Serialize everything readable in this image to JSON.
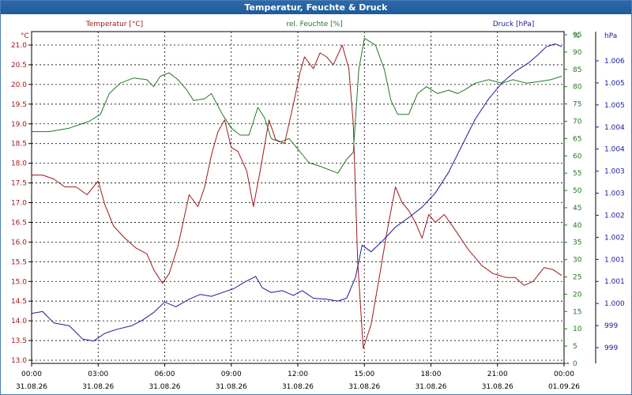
{
  "window": {
    "title": "Temperatur, Feuchte & Druck"
  },
  "chart_data": {
    "type": "line",
    "title": "Temperatur, Feuchte & Druck",
    "x": [
      "00:00 31.08.26",
      "03:00 31.08.26",
      "06:00 31.08.26",
      "09:00 31.08.26",
      "12:00 31.08.26",
      "15:00 31.08.26",
      "18:00 31.08.26",
      "21:00 31.08.26",
      "00:00 01.09.26"
    ],
    "x_hours_range": [
      0,
      24
    ],
    "grid": true,
    "axes": {
      "temperature": {
        "label": "Temperatur [°C]",
        "unit": "°C",
        "side": "left",
        "range": [
          13.0,
          21.0
        ],
        "ticks": [
          "13.0",
          "13.5",
          "14.0",
          "14.5",
          "15.0",
          "15.5",
          "16.0",
          "16.5",
          "17.0",
          "17.5",
          "18.0",
          "18.5",
          "19.0",
          "19.5",
          "20.0",
          "20.5",
          "21.0"
        ]
      },
      "humidity": {
        "label": "rel. Feuchte [%]",
        "unit": "%",
        "side": "right-inner",
        "range": [
          0,
          95
        ],
        "ticks": [
          "0",
          "5",
          "10",
          "15",
          "20",
          "25",
          "30",
          "35",
          "40",
          "45",
          "50",
          "55",
          "60",
          "65",
          "70",
          "75",
          "80",
          "85",
          "90",
          "95"
        ]
      },
      "pressure": {
        "label": "Druck [hPa]",
        "unit": "hPa",
        "side": "right-outer",
        "ticks": [
          "999",
          "999",
          "1.000",
          "1.001",
          "1.001",
          "1.002",
          "1.002",
          "1.003",
          "1.003",
          "1.004",
          "1.004",
          "1.005",
          "1.005",
          "1.006"
        ]
      }
    },
    "x_tick_times": [
      "00:00",
      "03:00",
      "06:00",
      "09:00",
      "12:00",
      "15:00",
      "18:00",
      "21:00",
      "00:00"
    ],
    "x_tick_dates": [
      "31.08.26",
      "31.08.26",
      "31.08.26",
      "31.08.26",
      "31.08.26",
      "31.08.26",
      "31.08.26",
      "31.08.26",
      "01.09.26"
    ],
    "series": [
      {
        "name": "Temperatur [°C]",
        "axis": "temperature",
        "color": "#a01818",
        "points": [
          [
            0,
            17.7
          ],
          [
            0.5,
            17.7
          ],
          [
            1,
            17.6
          ],
          [
            1.5,
            17.4
          ],
          [
            2,
            17.4
          ],
          [
            2.5,
            17.2
          ],
          [
            3,
            17.55
          ],
          [
            3.3,
            16.95
          ],
          [
            3.7,
            16.4
          ],
          [
            4.2,
            16.1
          ],
          [
            4.7,
            15.85
          ],
          [
            5.2,
            15.7
          ],
          [
            5.5,
            15.3
          ],
          [
            5.9,
            14.95
          ],
          [
            6.2,
            15.2
          ],
          [
            6.6,
            15.9
          ],
          [
            7.1,
            17.2
          ],
          [
            7.5,
            16.9
          ],
          [
            7.8,
            17.4
          ],
          [
            8.1,
            18.2
          ],
          [
            8.4,
            18.8
          ],
          [
            8.7,
            19.1
          ],
          [
            9.0,
            18.4
          ],
          [
            9.3,
            18.3
          ],
          [
            9.7,
            17.8
          ],
          [
            10.0,
            16.9
          ],
          [
            10.3,
            17.8
          ],
          [
            10.7,
            19.1
          ],
          [
            11.0,
            18.6
          ],
          [
            11.4,
            18.5
          ],
          [
            11.8,
            19.5
          ],
          [
            12.1,
            20.3
          ],
          [
            12.3,
            20.7
          ],
          [
            12.7,
            20.4
          ],
          [
            13.0,
            20.8
          ],
          [
            13.3,
            20.7
          ],
          [
            13.6,
            20.5
          ],
          [
            14.0,
            21.0
          ],
          [
            14.3,
            20.4
          ],
          [
            14.5,
            19.0
          ],
          [
            14.7,
            15.5
          ],
          [
            14.95,
            13.3
          ],
          [
            15.3,
            13.9
          ],
          [
            15.7,
            15.2
          ],
          [
            16.0,
            16.2
          ],
          [
            16.4,
            17.4
          ],
          [
            16.7,
            17.0
          ],
          [
            17.0,
            16.8
          ],
          [
            17.3,
            16.5
          ],
          [
            17.6,
            16.1
          ],
          [
            17.9,
            16.7
          ],
          [
            18.2,
            16.5
          ],
          [
            18.6,
            16.7
          ],
          [
            19.1,
            16.3
          ],
          [
            19.7,
            15.8
          ],
          [
            20.3,
            15.4
          ],
          [
            20.8,
            15.2
          ],
          [
            21.4,
            15.1
          ],
          [
            21.8,
            15.1
          ],
          [
            22.2,
            14.9
          ],
          [
            22.6,
            15.0
          ],
          [
            23.1,
            15.35
          ],
          [
            23.5,
            15.3
          ],
          [
            23.9,
            15.15
          ]
        ]
      },
      {
        "name": "rel. Feuchte [%]",
        "axis": "humidity",
        "color": "#1f7a1f",
        "points": [
          [
            0,
            67.0
          ],
          [
            0.8,
            67.0
          ],
          [
            1.7,
            68.0
          ],
          [
            2.6,
            70.0
          ],
          [
            3.1,
            72.0
          ],
          [
            3.5,
            78.0
          ],
          [
            4.0,
            81.0
          ],
          [
            4.6,
            82.5
          ],
          [
            5.2,
            82.0
          ],
          [
            5.5,
            80.0
          ],
          [
            5.8,
            83.0
          ],
          [
            6.2,
            84.0
          ],
          [
            6.6,
            82.0
          ],
          [
            7.0,
            79.0
          ],
          [
            7.3,
            76.0
          ],
          [
            7.8,
            76.5
          ],
          [
            8.1,
            78.0
          ],
          [
            8.6,
            72.0
          ],
          [
            9.0,
            68.0
          ],
          [
            9.4,
            66.0
          ],
          [
            9.8,
            66.0
          ],
          [
            10.2,
            74.0
          ],
          [
            10.5,
            71.0
          ],
          [
            10.8,
            65.0
          ],
          [
            11.2,
            64.0
          ],
          [
            11.6,
            65.0
          ],
          [
            12.0,
            62.0
          ],
          [
            12.5,
            58.0
          ],
          [
            13.0,
            57.0
          ],
          [
            13.4,
            56.0
          ],
          [
            13.8,
            55.0
          ],
          [
            14.2,
            59.0
          ],
          [
            14.5,
            61.0
          ],
          [
            14.75,
            85.0
          ],
          [
            15.0,
            94.0
          ],
          [
            15.5,
            92.0
          ],
          [
            15.9,
            85.0
          ],
          [
            16.2,
            76.0
          ],
          [
            16.5,
            72.0
          ],
          [
            17.0,
            72.0
          ],
          [
            17.4,
            78.0
          ],
          [
            17.8,
            80.0
          ],
          [
            18.3,
            78.0
          ],
          [
            18.8,
            79.0
          ],
          [
            19.2,
            78.0
          ],
          [
            19.5,
            79.0
          ],
          [
            20.0,
            81.0
          ],
          [
            20.6,
            82.0
          ],
          [
            21.2,
            81.0
          ],
          [
            21.7,
            82.0
          ],
          [
            22.3,
            81.0
          ],
          [
            22.9,
            81.5
          ],
          [
            23.4,
            82.0
          ],
          [
            23.9,
            83.0
          ]
        ]
      },
      {
        "name": "Druck [hPa]",
        "axis": "pressure",
        "color": "#1a1a9a",
        "points": [
          [
            0,
            998.91
          ],
          [
            0.5,
            998.93
          ],
          [
            1.0,
            998.81
          ],
          [
            1.7,
            998.78
          ],
          [
            2.3,
            998.64
          ],
          [
            2.8,
            998.62
          ],
          [
            3.3,
            998.7
          ],
          [
            3.8,
            998.74
          ],
          [
            4.5,
            998.78
          ],
          [
            5.0,
            998.84
          ],
          [
            5.5,
            998.92
          ],
          [
            6.0,
            999.03
          ],
          [
            6.5,
            998.98
          ],
          [
            7.1,
            999.06
          ],
          [
            7.6,
            999.11
          ],
          [
            8.1,
            999.09
          ],
          [
            8.6,
            999.13
          ],
          [
            9.1,
            999.17
          ],
          [
            9.6,
            999.24
          ],
          [
            10.1,
            999.3
          ],
          [
            10.4,
            999.18
          ],
          [
            10.8,
            999.13
          ],
          [
            11.3,
            999.15
          ],
          [
            11.8,
            999.1
          ],
          [
            12.2,
            999.15
          ],
          [
            12.7,
            999.07
          ],
          [
            13.3,
            999.06
          ],
          [
            13.8,
            999.04
          ],
          [
            14.2,
            999.07
          ],
          [
            14.6,
            999.29
          ],
          [
            14.9,
            999.63
          ],
          [
            15.3,
            999.56
          ],
          [
            15.8,
            999.67
          ],
          [
            16.4,
            999.82
          ],
          [
            17.0,
            999.92
          ],
          [
            17.6,
            1000.03
          ],
          [
            18.2,
            1000.18
          ],
          [
            18.8,
            1000.4
          ],
          [
            19.4,
            1000.68
          ],
          [
            20.0,
            1000.96
          ],
          [
            20.6,
            1001.17
          ],
          [
            21.2,
            1001.34
          ],
          [
            21.8,
            1001.46
          ],
          [
            22.4,
            1001.55
          ],
          [
            22.8,
            1001.63
          ],
          [
            23.2,
            1001.72
          ],
          [
            23.6,
            1001.75
          ],
          [
            23.9,
            1001.72
          ]
        ]
      }
    ]
  }
}
